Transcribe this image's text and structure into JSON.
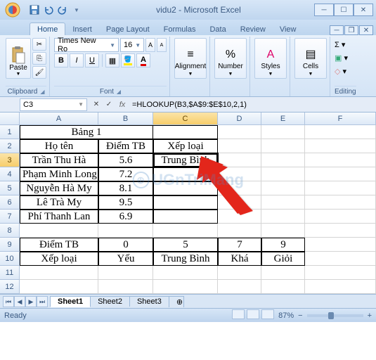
{
  "window": {
    "title": "vidu2 - Microsoft Excel"
  },
  "tabs": {
    "home": "Home",
    "insert": "Insert",
    "pagelayout": "Page Layout",
    "formulas": "Formulas",
    "data": "Data",
    "review": "Review",
    "view": "View"
  },
  "ribbon": {
    "clipboard": {
      "label": "Clipboard",
      "paste": "Paste"
    },
    "font": {
      "label": "Font",
      "name": "Times New Ro",
      "size": "16",
      "bold": "B",
      "italic": "I",
      "underline": "U"
    },
    "alignment": {
      "label": "Alignment"
    },
    "number": {
      "label": "Number",
      "pct": "%"
    },
    "styles": {
      "label": "Styles"
    },
    "cells": {
      "label": "Cells"
    },
    "editing": {
      "label": "Editing",
      "sigma": "Σ"
    }
  },
  "namebox": "C3",
  "formula": "=HLOOKUP(B3,$A$9:$E$10,2,1)",
  "cols": [
    "A",
    "B",
    "C",
    "D",
    "E",
    "F"
  ],
  "rows": [
    "1",
    "2",
    "3",
    "4",
    "5",
    "6",
    "7",
    "8",
    "9",
    "10",
    "11",
    "12"
  ],
  "grid": {
    "r1": {
      "A": "Bảng 1"
    },
    "r2": {
      "A": "Họ tên",
      "B": "Điểm TB",
      "C": "Xếp loại"
    },
    "r3": {
      "A": "Trần Thu Hà",
      "B": "5.6",
      "C": "Trung Bình"
    },
    "r4": {
      "A": "Phạm Minh Long",
      "B": "7.2"
    },
    "r5": {
      "A": "Nguyễn Hà My",
      "B": "8.1"
    },
    "r6": {
      "A": "Lê Trà My",
      "B": "9.5"
    },
    "r7": {
      "A": "Phí Thanh Lan",
      "B": "6.9"
    },
    "r9": {
      "A": "Điểm TB",
      "B": "0",
      "C": "5",
      "D": "7",
      "E": "9"
    },
    "r10": {
      "A": "Xếp loại",
      "B": "Yếu",
      "C": "Trung Bình",
      "D": "Khá",
      "E": "Giỏi"
    }
  },
  "sheets": {
    "s1": "Sheet1",
    "s2": "Sheet2",
    "s3": "Sheet3"
  },
  "status": {
    "ready": "Ready",
    "zoom": "87%"
  },
  "watermark": "UGnTriMang"
}
